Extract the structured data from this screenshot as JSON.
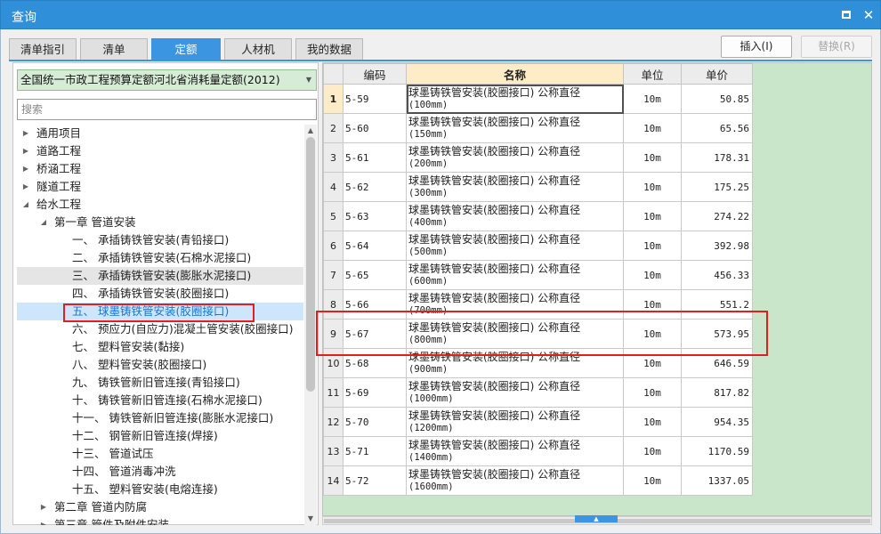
{
  "window": {
    "title": "查询",
    "maximize_icon": "maximize-icon",
    "close_icon": "close-icon",
    "close_glyph": "✕"
  },
  "tabs": [
    {
      "label": "清单指引",
      "active": false
    },
    {
      "label": "清单",
      "active": false
    },
    {
      "label": "定额",
      "active": true
    },
    {
      "label": "人材机",
      "active": false
    },
    {
      "label": "我的数据",
      "active": false
    }
  ],
  "buttons": {
    "insert": "插入(I)",
    "replace": "替换(R)"
  },
  "library": {
    "selected": "全国统一市政工程预算定额河北省消耗量定额(2012)"
  },
  "search": {
    "placeholder": "搜索"
  },
  "tree": [
    {
      "label": "通用项目",
      "level": 0,
      "toggle": "right"
    },
    {
      "label": "道路工程",
      "level": 0,
      "toggle": "right"
    },
    {
      "label": "桥涵工程",
      "level": 0,
      "toggle": "right"
    },
    {
      "label": "隧道工程",
      "level": 0,
      "toggle": "right"
    },
    {
      "label": "给水工程",
      "level": 0,
      "toggle": "down"
    },
    {
      "label": "第一章 管道安装",
      "level": 1,
      "toggle": "down"
    },
    {
      "label": "一、 承插铸铁管安装(青铅接口)",
      "level": 2
    },
    {
      "label": "二、 承插铸铁管安装(石棉水泥接口)",
      "level": 2
    },
    {
      "label": "三、 承插铸铁管安装(膨胀水泥接口)",
      "level": 2,
      "state": "hover"
    },
    {
      "label": "四、 承插铸铁管安装(胶圈接口)",
      "level": 2
    },
    {
      "label": "五、 球墨铸铁管安装(胶圈接口)",
      "level": 2,
      "state": "selected"
    },
    {
      "label": "六、 预应力(自应力)混凝土管安装(胶圈接口)",
      "level": 2
    },
    {
      "label": "七、 塑料管安装(黏接)",
      "level": 2
    },
    {
      "label": "八、 塑料管安装(胶圈接口)",
      "level": 2
    },
    {
      "label": "九、 铸铁管新旧管连接(青铅接口)",
      "level": 2
    },
    {
      "label": "十、 铸铁管新旧管连接(石棉水泥接口)",
      "level": 2
    },
    {
      "label": "十一、 铸铁管新旧管连接(膨胀水泥接口)",
      "level": 2
    },
    {
      "label": "十二、 钢管新旧管连接(焊接)",
      "level": 2
    },
    {
      "label": "十三、 管道试压",
      "level": 2
    },
    {
      "label": "十四、 管道消毒冲洗",
      "level": 2
    },
    {
      "label": "十五、 塑料管安装(电熔连接)",
      "level": 2
    },
    {
      "label": "第二章 管道内防腐",
      "level": 1,
      "toggle": "right"
    },
    {
      "label": "第三章 管件及附件安装",
      "level": 1,
      "toggle": "right",
      "clipped": true
    }
  ],
  "table": {
    "columns": [
      "编码",
      "名称",
      "单位",
      "单价"
    ],
    "rows": [
      {
        "num": "1",
        "code": "5-59",
        "name": "球墨铸铁管安装(胶圈接口) 公称直径",
        "spec": "(100mm)",
        "unit": "10m",
        "price": "50.85"
      },
      {
        "num": "2",
        "code": "5-60",
        "name": "球墨铸铁管安装(胶圈接口) 公称直径",
        "spec": "(150mm)",
        "unit": "10m",
        "price": "65.56"
      },
      {
        "num": "3",
        "code": "5-61",
        "name": "球墨铸铁管安装(胶圈接口) 公称直径",
        "spec": "(200mm)",
        "unit": "10m",
        "price": "178.31"
      },
      {
        "num": "4",
        "code": "5-62",
        "name": "球墨铸铁管安装(胶圈接口) 公称直径",
        "spec": "(300mm)",
        "unit": "10m",
        "price": "175.25"
      },
      {
        "num": "5",
        "code": "5-63",
        "name": "球墨铸铁管安装(胶圈接口) 公称直径",
        "spec": "(400mm)",
        "unit": "10m",
        "price": "274.22"
      },
      {
        "num": "6",
        "code": "5-64",
        "name": "球墨铸铁管安装(胶圈接口) 公称直径",
        "spec": "(500mm)",
        "unit": "10m",
        "price": "392.98"
      },
      {
        "num": "7",
        "code": "5-65",
        "name": "球墨铸铁管安装(胶圈接口) 公称直径",
        "spec": "(600mm)",
        "unit": "10m",
        "price": "456.33"
      },
      {
        "num": "8",
        "code": "5-66",
        "name": "球墨铸铁管安装(胶圈接口) 公称直径",
        "spec": "(700mm)",
        "unit": "10m",
        "price": "551.2"
      },
      {
        "num": "9",
        "code": "5-67",
        "name": "球墨铸铁管安装(胶圈接口) 公称直径",
        "spec": "(800mm)",
        "unit": "10m",
        "price": "573.95"
      },
      {
        "num": "10",
        "code": "5-68",
        "name": "球墨铸铁管安装(胶圈接口) 公称直径",
        "spec": "(900mm)",
        "unit": "10m",
        "price": "646.59"
      },
      {
        "num": "11",
        "code": "5-69",
        "name": "球墨铸铁管安装(胶圈接口) 公称直径",
        "spec": "(1000mm)",
        "unit": "10m",
        "price": "817.82"
      },
      {
        "num": "12",
        "code": "5-70",
        "name": "球墨铸铁管安装(胶圈接口) 公称直径",
        "spec": "(1200mm)",
        "unit": "10m",
        "price": "954.35"
      },
      {
        "num": "13",
        "code": "5-71",
        "name": "球墨铸铁管安装(胶圈接口) 公称直径",
        "spec": "(1400mm)",
        "unit": "10m",
        "price": "1170.59"
      },
      {
        "num": "14",
        "code": "5-72",
        "name": "球墨铸铁管安装(胶圈接口) 公称直径",
        "spec": "(1600mm)",
        "unit": "10m",
        "price": "1337.05"
      }
    ],
    "current_row": 1,
    "highlighted_row": 9
  },
  "colors": {
    "accent": "#3c95e0",
    "title_bar": "#2f8fd8",
    "highlight_box": "#e02020",
    "grid_background": "#c9e5ca"
  }
}
